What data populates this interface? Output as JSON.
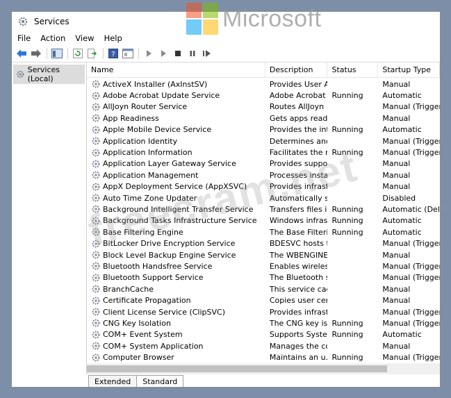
{
  "window": {
    "title": "Services"
  },
  "menu": [
    "File",
    "Action",
    "View",
    "Help"
  ],
  "tree": {
    "root_label": "Services (Local)"
  },
  "columns": {
    "name": "Name",
    "description": "Description",
    "status": "Status",
    "startup": "Startup Type"
  },
  "services": [
    {
      "name": "ActiveX Installer (AxInstSV)",
      "description": "Provides User A...",
      "status": "",
      "startup": "Manual"
    },
    {
      "name": "Adobe Acrobat Update Service",
      "description": "Adobe Acrobat ...",
      "status": "Running",
      "startup": "Automatic"
    },
    {
      "name": "AllJoyn Router Service",
      "description": "Routes AllJoyn ...",
      "status": "",
      "startup": "Manual (Trigger S"
    },
    {
      "name": "App Readiness",
      "description": "Gets apps ready...",
      "status": "",
      "startup": "Manual"
    },
    {
      "name": "Apple Mobile Device Service",
      "description": "Provides the int...",
      "status": "Running",
      "startup": "Automatic"
    },
    {
      "name": "Application Identity",
      "description": "Determines and...",
      "status": "",
      "startup": "Manual (Trigger S"
    },
    {
      "name": "Application Information",
      "description": "Facilitates the r...",
      "status": "Running",
      "startup": "Manual (Trigger S"
    },
    {
      "name": "Application Layer Gateway Service",
      "description": "Provides suppo...",
      "status": "",
      "startup": "Manual"
    },
    {
      "name": "Application Management",
      "description": "Processes instal...",
      "status": "",
      "startup": "Manual"
    },
    {
      "name": "AppX Deployment Service (AppXSVC)",
      "description": "Provides infrast...",
      "status": "",
      "startup": "Manual"
    },
    {
      "name": "Auto Time Zone Updater",
      "description": "Automatically s...",
      "status": "",
      "startup": "Disabled"
    },
    {
      "name": "Background Intelligent Transfer Service",
      "description": "Transfers files in...",
      "status": "Running",
      "startup": "Automatic (Delay"
    },
    {
      "name": "Background Tasks Infrastructure Service",
      "description": "Windows infras...",
      "status": "Running",
      "startup": "Automatic"
    },
    {
      "name": "Base Filtering Engine",
      "description": "The Base Filteri...",
      "status": "Running",
      "startup": "Automatic"
    },
    {
      "name": "BitLocker Drive Encryption Service",
      "description": "BDESVC hosts t...",
      "status": "",
      "startup": "Manual (Trigger S"
    },
    {
      "name": "Block Level Backup Engine Service",
      "description": "The WBENGINE ...",
      "status": "",
      "startup": "Manual"
    },
    {
      "name": "Bluetooth Handsfree Service",
      "description": "Enables wireless...",
      "status": "",
      "startup": "Manual (Trigger S"
    },
    {
      "name": "Bluetooth Support Service",
      "description": "The Bluetooth s...",
      "status": "",
      "startup": "Manual (Trigger S"
    },
    {
      "name": "BranchCache",
      "description": "This service cac...",
      "status": "",
      "startup": "Manual"
    },
    {
      "name": "Certificate Propagation",
      "description": "Copies user cert...",
      "status": "",
      "startup": "Manual"
    },
    {
      "name": "Client License Service (ClipSVC)",
      "description": "Provides infrast...",
      "status": "",
      "startup": "Manual (Trigger S"
    },
    {
      "name": "CNG Key Isolation",
      "description": "The CNG key is...",
      "status": "Running",
      "startup": "Manual (Trigger S"
    },
    {
      "name": "COM+ Event System",
      "description": "Supports Syste...",
      "status": "Running",
      "startup": "Automatic"
    },
    {
      "name": "COM+ System Application",
      "description": "Manages the co...",
      "status": "",
      "startup": "Manual"
    },
    {
      "name": "Computer Browser",
      "description": "Maintains an u...",
      "status": "Running",
      "startup": "Manual (Trigger S"
    }
  ],
  "tabs": [
    "Extended",
    "Standard"
  ],
  "watermark": {
    "brand": "Microsoft",
    "site": "freecram.net"
  },
  "colors": {
    "ms_red": "#f25022",
    "ms_green": "#7fba00",
    "ms_blue": "#00a4ef",
    "ms_yellow": "#ffb900",
    "background": "#7d8fa8"
  }
}
